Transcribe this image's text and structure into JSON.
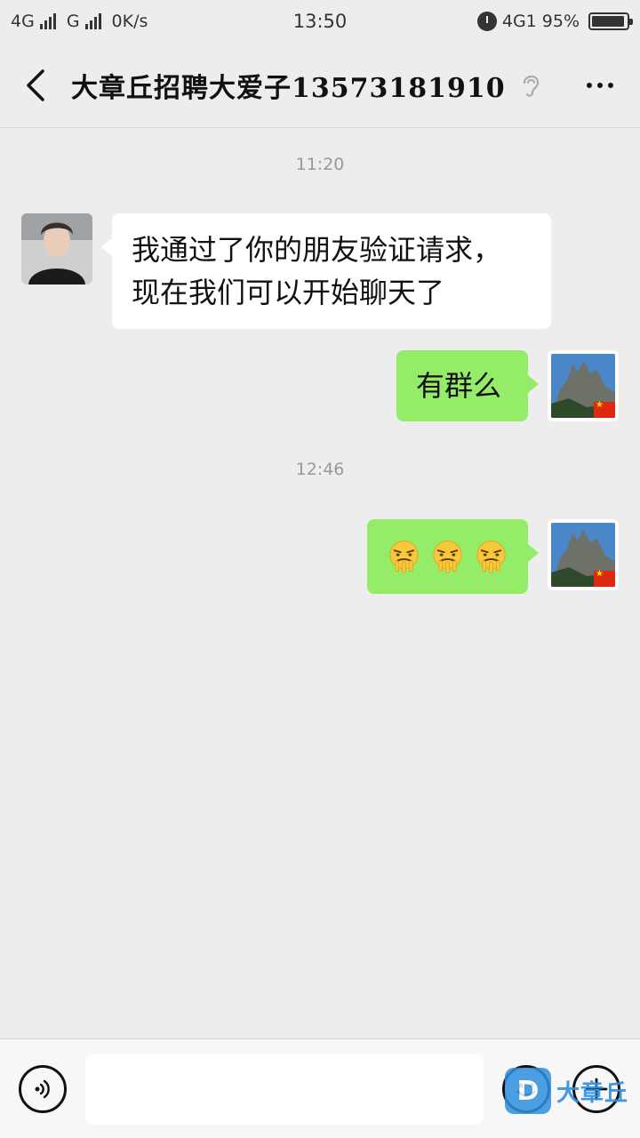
{
  "status_bar": {
    "network1": "4G",
    "network2": "G",
    "speed": "0K/s",
    "time": "13:50",
    "network3": "4G1",
    "battery": "95%",
    "battery_level": 0.95
  },
  "header": {
    "title": "大章丘招聘大爱子13573181910"
  },
  "messages": [
    {
      "type": "timestamp",
      "text": "11:20"
    },
    {
      "type": "incoming",
      "lines": [
        "我通过了你的朋友验证请求，",
        "现在我们可以开始聊天了"
      ]
    },
    {
      "type": "outgoing",
      "text": "有群么"
    },
    {
      "type": "timestamp",
      "text": "12:46"
    },
    {
      "type": "outgoing-emoji",
      "emoji_icons": [
        "drooling-face-icon",
        "drooling-face-icon",
        "drooling-face-icon"
      ]
    }
  ],
  "contact_avatar_icon": "person-avatar",
  "self_avatar_icon": "mountain-landscape-avatar",
  "input_bar": {
    "placeholder": "",
    "voice_icon": "voice-icon",
    "emoji_icon": "emoji-icon",
    "plus_icon": "plus-icon"
  },
  "watermark": {
    "logo": "D",
    "text": "大章丘"
  },
  "colors": {
    "background": "#ededed",
    "outgoing_bubble": "#95ec69",
    "incoming_bubble": "#ffffff",
    "watermark": "#2f8fe0"
  }
}
